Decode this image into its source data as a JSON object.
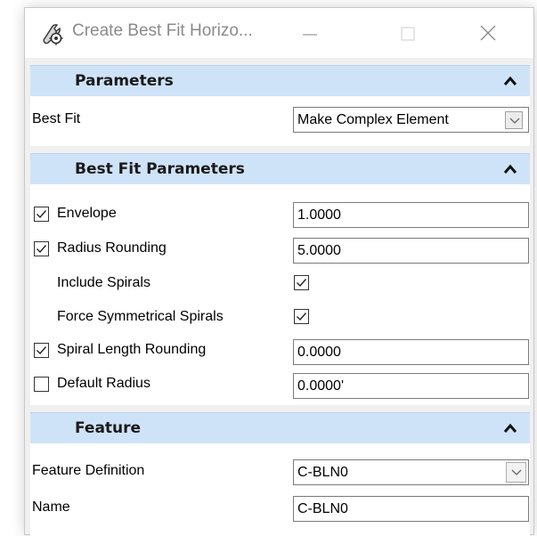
{
  "window": {
    "title": "Create Best Fit Horizo..."
  },
  "sections": {
    "parameters": {
      "title": "Parameters",
      "best_fit_label": "Best Fit",
      "best_fit_value": "Make Complex Element"
    },
    "best_fit_parameters": {
      "title": "Best Fit Parameters",
      "envelope_label": "Envelope",
      "envelope_checked": true,
      "envelope_value": "1.0000",
      "radius_rounding_label": "Radius Rounding",
      "radius_rounding_checked": true,
      "radius_rounding_value": "5.0000",
      "include_spirals_label": "Include Spirals",
      "include_spirals_checked": true,
      "force_symmetrical_spirals_label": "Force Symmetrical Spirals",
      "force_symmetrical_spirals_checked": true,
      "spiral_length_rounding_label": "Spiral Length Rounding",
      "spiral_length_rounding_checked": true,
      "spiral_length_rounding_value": "0.0000",
      "default_radius_label": "Default Radius",
      "default_radius_checked": false,
      "default_radius_value": "0.0000'"
    },
    "feature": {
      "title": "Feature",
      "feature_definition_label": "Feature Definition",
      "feature_definition_value": "C-BLN0",
      "name_label": "Name",
      "name_value": "C-BLN0"
    }
  },
  "icons": {
    "app": "tools-icon",
    "collapse": "chevron-up-icon",
    "dropdown": "chevron-down-icon",
    "check": "check-icon"
  },
  "colors": {
    "section_header_bg": "#cfe3f8",
    "panel_bg": "#ffffff",
    "window_bg": "#f0f0f0"
  }
}
